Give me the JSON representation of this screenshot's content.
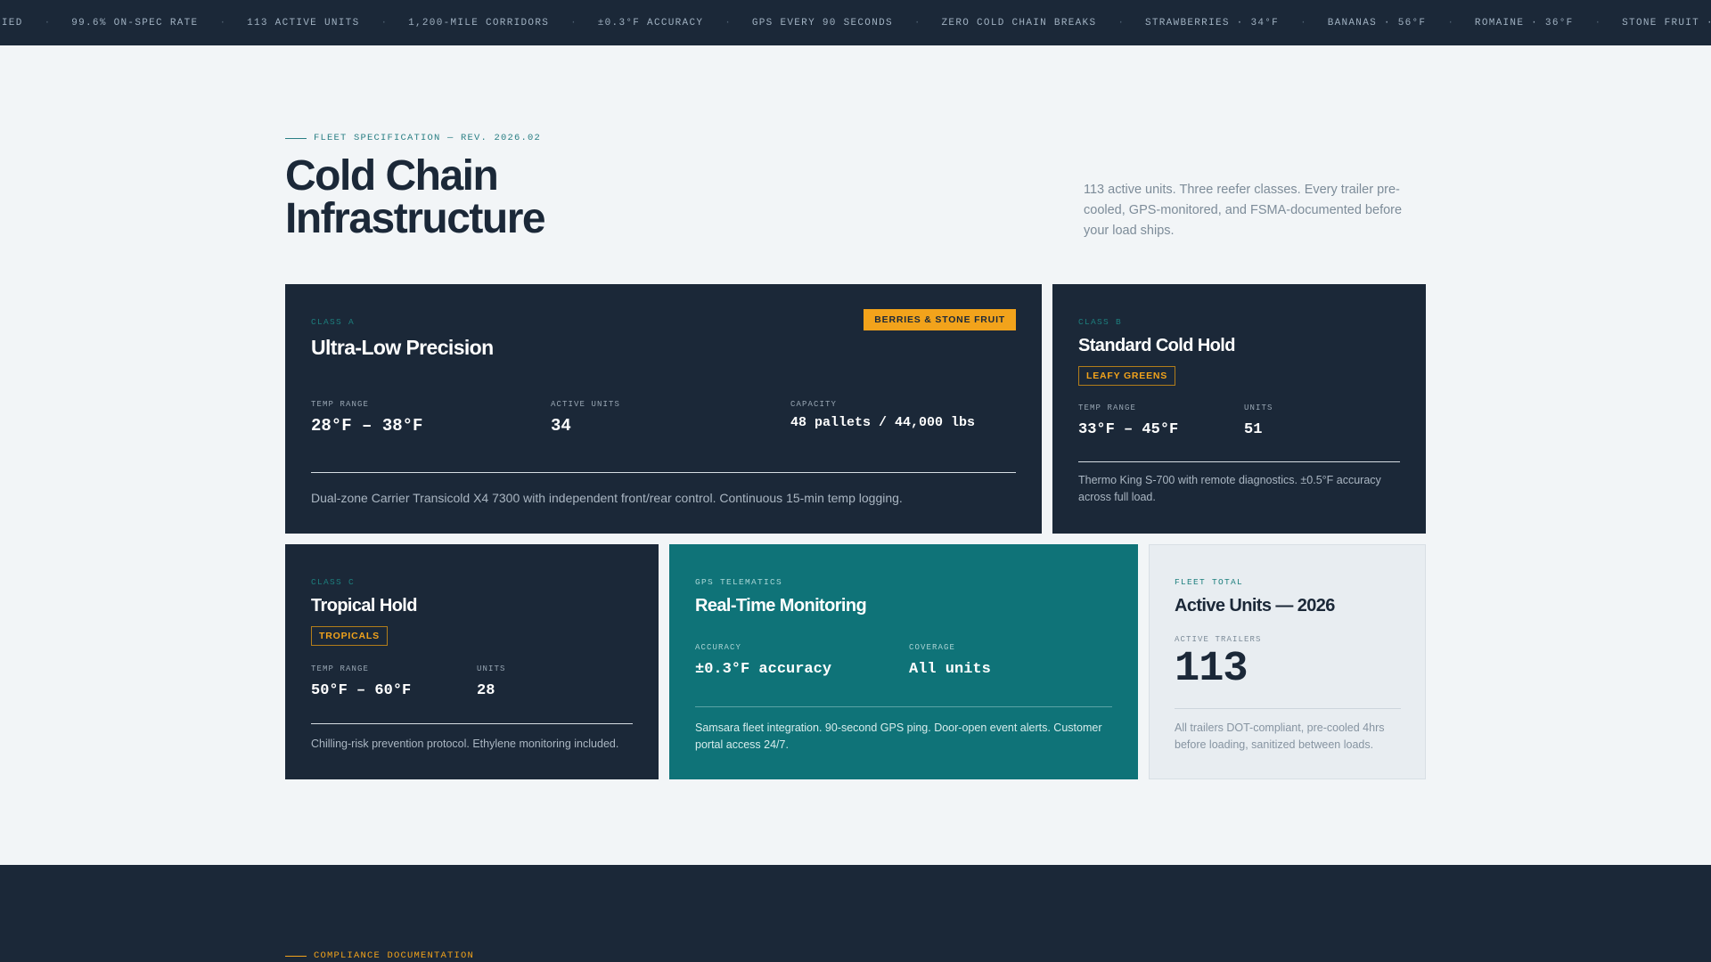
{
  "ticker": {
    "items": [
      "FIED",
      "99.6% ON-SPEC RATE",
      "113 ACTIVE UNITS",
      "1,200-MILE CORRIDORS",
      "±0.3°F ACCURACY",
      "GPS EVERY 90 SECONDS",
      "ZERO COLD CHAIN BREAKS",
      "STRAWBERRIES · 34°F",
      "BANANAS · 56°F",
      "ROMAINE · 36°F",
      "STONE FRUIT ·"
    ],
    "separator": "·"
  },
  "header": {
    "eyebrow": "FLEET SPECIFICATION — REV. 2026.02",
    "title_line1": "Cold Chain",
    "title_line2": "Infrastructure",
    "intro": "113 active units. Three reefer classes. Every trailer pre-cooled, GPS-monitored, and FSMA-documented before your load ships."
  },
  "cards": {
    "class_a": {
      "class_label": "CLASS A",
      "title": "Ultra-Low Precision",
      "badge": "BERRIES & STONE FRUIT",
      "stats": [
        {
          "label": "TEMP RANGE",
          "value": "28°F – 38°F"
        },
        {
          "label": "ACTIVE UNITS",
          "value": "34"
        },
        {
          "label": "CAPACITY",
          "value": "48 pallets / 44,000 lbs"
        }
      ],
      "description": "Dual-zone Carrier Transicold X4 7300 with independent front/rear control. Continuous 15-min temp logging."
    },
    "class_b": {
      "class_label": "CLASS B",
      "title": "Standard Cold Hold",
      "badge": "LEAFY GREENS",
      "stats": [
        {
          "label": "TEMP RANGE",
          "value": "33°F – 45°F"
        },
        {
          "label": "UNITS",
          "value": "51"
        }
      ],
      "description": "Thermo King S-700 with remote diagnostics. ±0.5°F accuracy across full load."
    },
    "class_c": {
      "class_label": "CLASS C",
      "title": "Tropical Hold",
      "badge": "TROPICALS",
      "stats": [
        {
          "label": "TEMP RANGE",
          "value": "50°F – 60°F"
        },
        {
          "label": "UNITS",
          "value": "28"
        }
      ],
      "description": "Chilling-risk prevention protocol. Ethylene monitoring included."
    },
    "gps": {
      "class_label": "GPS TELEMATICS",
      "title": "Real-Time Monitoring",
      "stats": [
        {
          "label": "ACCURACY",
          "value": "±0.3°F accuracy"
        },
        {
          "label": "COVERAGE",
          "value": "All units"
        }
      ],
      "description": "Samsara fleet integration. 90-second GPS ping. Door-open event alerts. Customer portal access 24/7."
    },
    "fleet": {
      "class_label": "FLEET TOTAL",
      "title": "Active Units — 2026",
      "stat_label": "ACTIVE TRAILERS",
      "stat_value": "113",
      "description": "All trailers DOT-compliant, pre-cooled 4hrs before loading, sanitized between loads."
    }
  },
  "footer": {
    "eyebrow": "COMPLIANCE DOCUMENTATION"
  },
  "colors": {
    "navy": "#1b2838",
    "teal": "#0f7378",
    "amber": "#f2a31b",
    "page_bg": "#f2f5f7"
  }
}
